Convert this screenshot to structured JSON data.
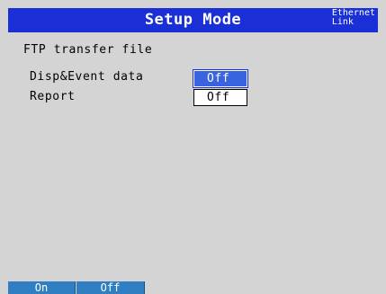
{
  "header": {
    "title": "Setup Mode",
    "ethernet_line1": "Ethernet",
    "ethernet_line2": "Link"
  },
  "section": {
    "title": "FTP transfer file"
  },
  "settings": [
    {
      "label": "Disp&Event data",
      "value": "Off",
      "selected": true
    },
    {
      "label": "Report",
      "value": "Off",
      "selected": false
    }
  ],
  "softkeys": [
    {
      "label": "On"
    },
    {
      "label": "Off"
    }
  ],
  "colors": {
    "title_bar": "#1a2fd6",
    "screen_bg": "#d4d4d4",
    "selected_field": "#3a63df",
    "softkey": "#2f7fc2"
  }
}
